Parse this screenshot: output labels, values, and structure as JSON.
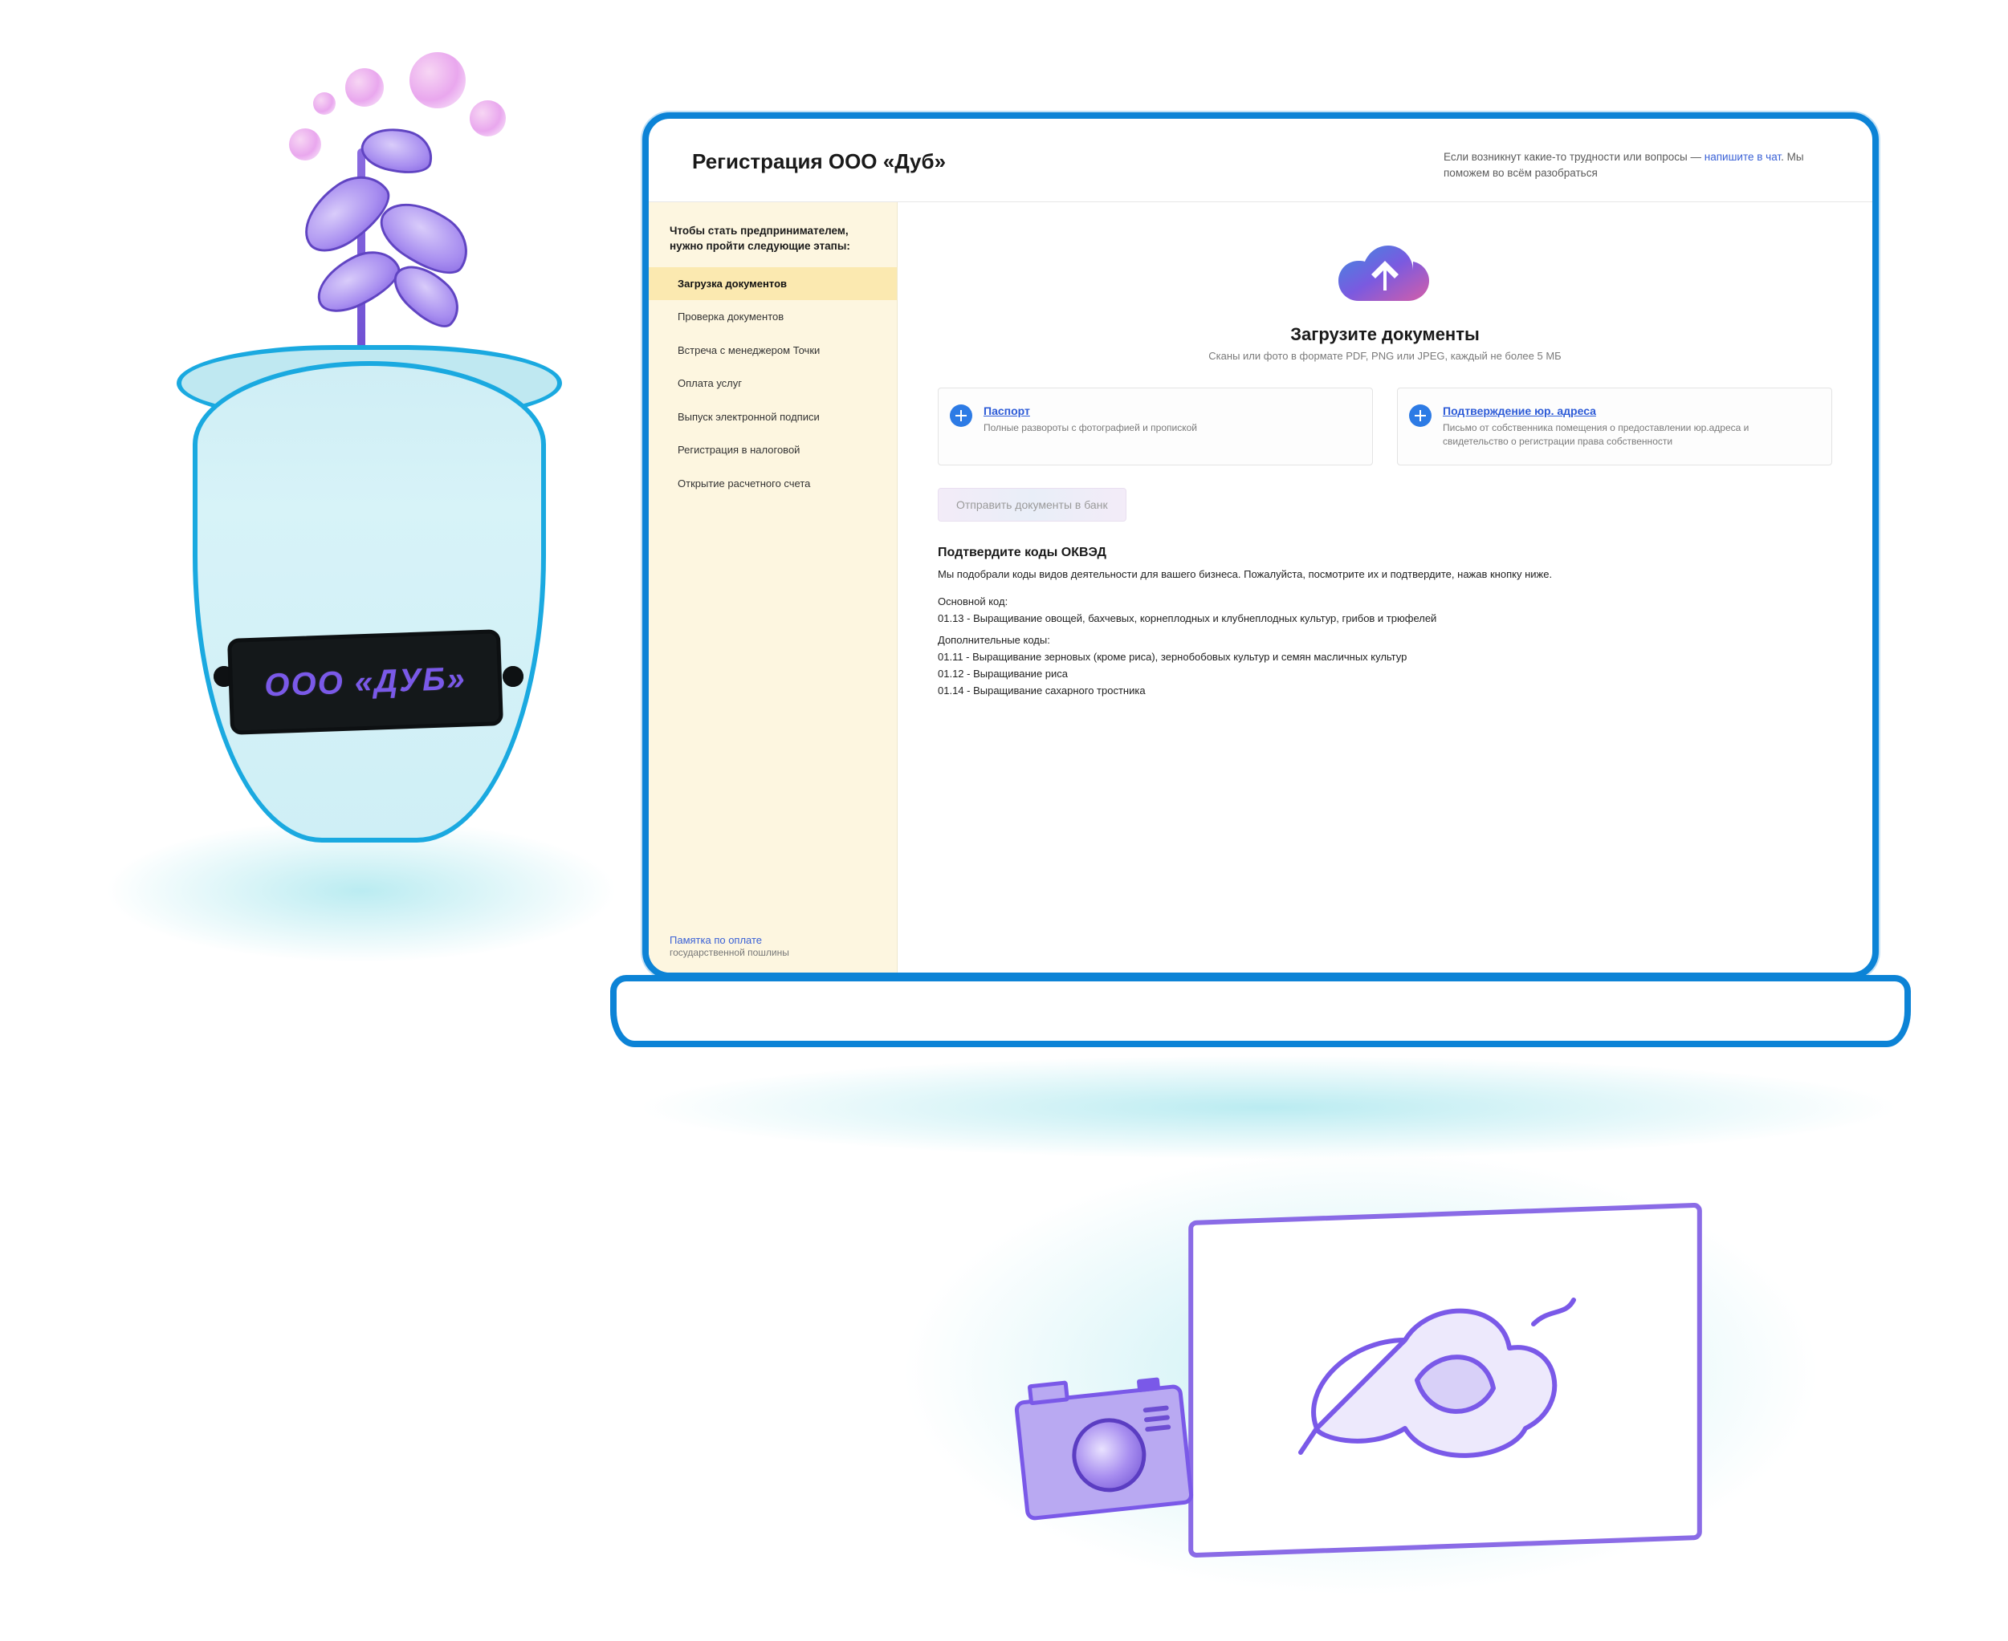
{
  "pot": {
    "label": "ООО «ДУБ»"
  },
  "header": {
    "title": "Регистрация ООО «Дуб»",
    "help_prefix": "Если возникнут какие-то трудности или вопросы — ",
    "help_link": "напишите в чат",
    "help_suffix": ". Мы поможем во всём разобраться"
  },
  "sidebar": {
    "title": "Чтобы стать предпринимателем, нужно пройти следующие этапы:",
    "steps": [
      "Загрузка документов",
      "Проверка документов",
      "Встреча с менеджером Точки",
      "Оплата услуг",
      "Выпуск электронной подписи",
      "Регистрация в налоговой",
      "Открытие расчетного счета"
    ],
    "footer_link": "Памятка по оплате",
    "footer_sub": "государственной пошлины"
  },
  "upload": {
    "title": "Загрузите документы",
    "subtitle": "Сканы или фото в формате PDF, PNG или JPEG, каждый не более 5 МБ"
  },
  "cards": {
    "passport_title": "Паспорт",
    "passport_desc": "Полные развороты с фотографией и пропиской",
    "address_title": "Подтверждение юр. адреса",
    "address_desc": "Письмо от собственника помещения о предоставлении юр.адреса и свидетельство о регистрации права собственности"
  },
  "send_button": "Отправить документы в банк",
  "okved": {
    "heading": "Подтвердите коды ОКВЭД",
    "intro": "Мы подобрали коды видов деятельности для вашего бизнеса. Пожалуйста, посмотрите их и подтвердите, нажав кнопку ниже.",
    "main_label": "Основной код:",
    "main_code": "01.13 - Выращивание овощей, бахчевых, корнеплодных и клубнеплодных культур, грибов и трюфелей",
    "extra_label": "Дополнительные коды:",
    "extra_codes": [
      "01.11 - Выращивание зерновых (кроме риса), зернобобовых культур и семян масличных культур",
      "01.12 - Выращивание риса",
      "01.14 - Выращивание сахарного тростника"
    ]
  }
}
